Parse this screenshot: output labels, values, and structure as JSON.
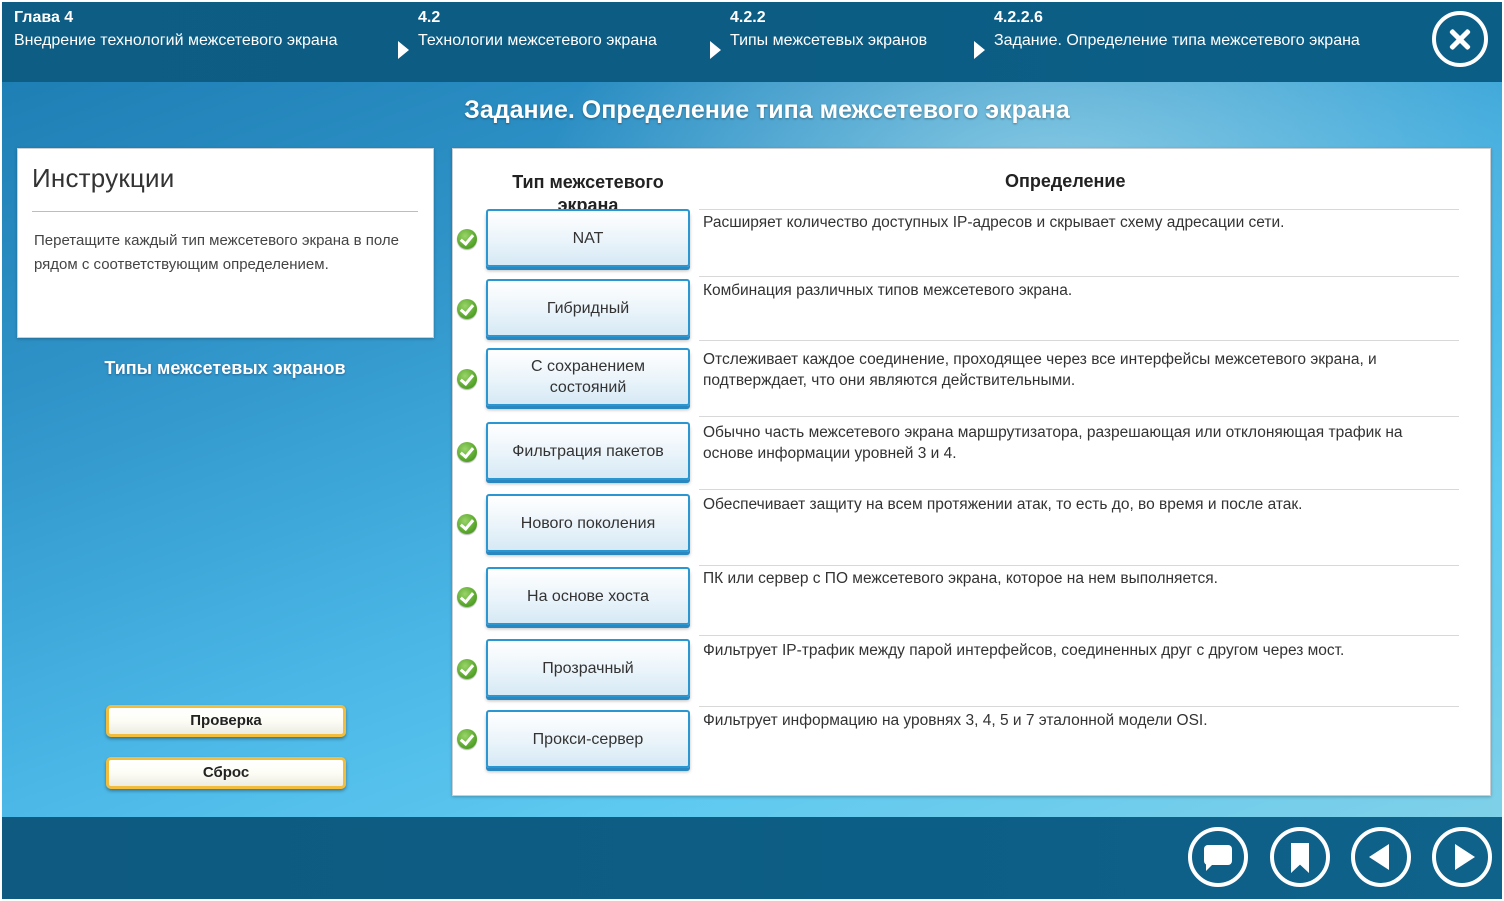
{
  "breadcrumb": [
    {
      "num": "Глава 4",
      "title": "Внедрение технологий межсетевого экрана"
    },
    {
      "num": "4.2",
      "title": "Технологии межсетевого экрана"
    },
    {
      "num": "4.2.2",
      "title": "Типы межсетевых экранов"
    },
    {
      "num": "4.2.2.6",
      "title": "Задание. Определение типа межсетевого экрана"
    }
  ],
  "page_title": "Задание. Определение типа межсетевого экрана",
  "instructions": {
    "heading": "Инструкции",
    "text": "Перетащите каждый тип межсетевого экрана в поле рядом с соответствующим определением."
  },
  "types_title": "Типы межсетевых экранов",
  "buttons": {
    "check": "Проверка",
    "reset": "Сброс"
  },
  "table": {
    "col_type": "Тип межсетевого экрана",
    "col_definition": "Определение",
    "rows": [
      {
        "type": "NAT",
        "definition": "Расширяет количество доступных IP-адресов и скрывает схему адресации сети.",
        "correct": true
      },
      {
        "type": "Гибридный",
        "definition": "Комбинация различных типов межсетевого экрана.",
        "correct": true
      },
      {
        "type": "С сохранением состояний",
        "definition": "Отслеживает каждое соединение, проходящее через все интерфейсы межсетевого экрана, и подтверждает, что они являются действительными.",
        "correct": true
      },
      {
        "type": "Фильтрация пакетов",
        "definition": "Обычно часть межсетевого экрана маршрутизатора, разрешающая или отклоняющая трафик на основе информации уровней 3 и 4.",
        "correct": true
      },
      {
        "type": "Нового поколения",
        "definition": "Обеспечивает защиту на всем протяжении атак, то есть до, во время и после атак.",
        "correct": true
      },
      {
        "type": "На основе хоста",
        "definition": "ПК или сервер с ПО межсетевого экрана, которое на нем выполняется.",
        "correct": true
      },
      {
        "type": "Прозрачный",
        "definition": "Фильтрует IP-трафик между парой интерфейсов, соединенных друг с другом через мост.",
        "correct": true
      },
      {
        "type": "Прокси-сервер",
        "definition": "Фильтрует информацию на уровнях 3, 4, 5 и 7 эталонной модели OSI.",
        "correct": true
      }
    ]
  },
  "icons": {
    "close": "close-icon",
    "chat": "chat-icon",
    "bookmark": "bookmark-icon",
    "prev": "previous-icon",
    "next": "next-icon",
    "check": "checkmark-icon",
    "arrow": "chevron-right-icon"
  },
  "colors": {
    "nav_bar": "#0d5d84",
    "tile_border": "#2a96d2",
    "button_border": "#f2bd3c",
    "check_green": "#5aa82d"
  }
}
